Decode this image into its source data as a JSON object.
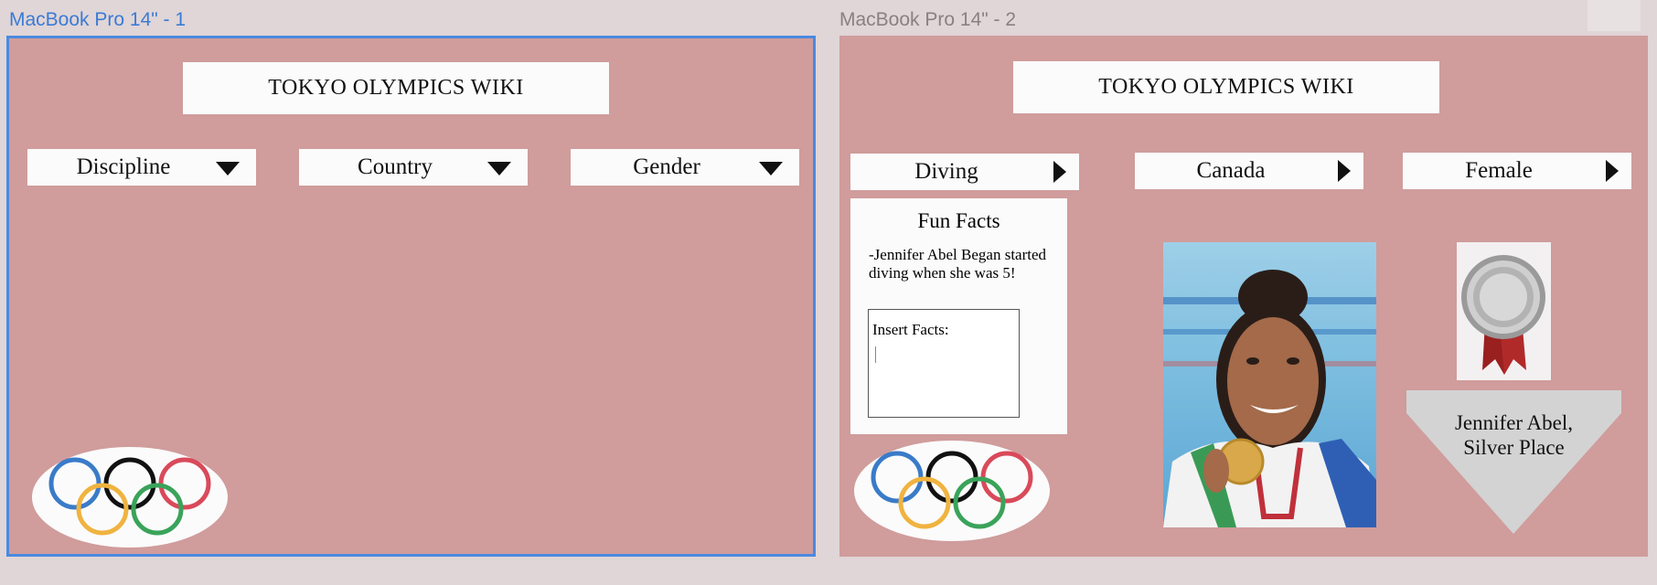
{
  "frames": [
    {
      "label": "MacBook Pro 14\" - 1",
      "title": "TOKYO OLYMPICS WIKI",
      "dropdowns": [
        "Discipline",
        "Country",
        "Gender"
      ]
    },
    {
      "label": "MacBook Pro 14\" - 2",
      "title": "TOKYO OLYMPICS WIKI",
      "dropdowns": [
        "Diving",
        "Canada",
        "Female"
      ],
      "fun_facts": {
        "title": "Fun Facts",
        "text": "-Jennifer Abel Began started diving when she was 5!",
        "input_label": "Insert Facts:"
      },
      "caption": [
        "Jennifer Abel,",
        "Silver Place"
      ]
    }
  ],
  "colors": {
    "canvas": "#e0d5d7",
    "frame_bg": "#d09c9c",
    "selection": "#4a8ae0",
    "ring_blue": "#3a7bc8",
    "ring_black": "#111111",
    "ring_red": "#d94a5a",
    "ring_yellow": "#f0b340",
    "ring_green": "#3aa35a"
  },
  "icons": [
    "triangle-down-icon",
    "triangle-right-icon",
    "olympic-rings-icon",
    "silver-medal-icon"
  ]
}
